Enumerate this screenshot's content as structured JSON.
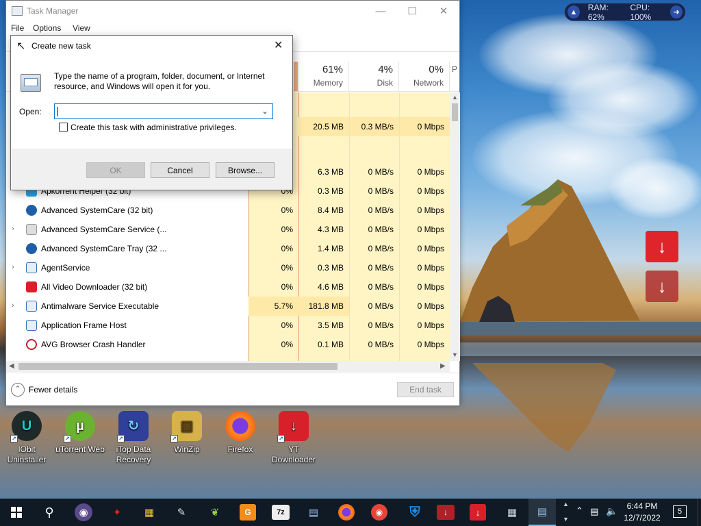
{
  "task_manager": {
    "title": "Task Manager",
    "menu": [
      "File",
      "Options",
      "View"
    ],
    "columns": [
      {
        "percent": "61%",
        "label": "Memory"
      },
      {
        "percent": "4%",
        "label": "Disk"
      },
      {
        "percent": "0%",
        "label": "Network"
      },
      {
        "percent": "",
        "label": "P"
      }
    ],
    "rows_partial": [
      {
        "cpu": "",
        "memory": "20.5 MB",
        "disk": "0.3 MB/s",
        "network": "0 Mbps"
      },
      {
        "cpu": "",
        "memory": "6.3 MB",
        "disk": "0 MB/s",
        "network": "0 Mbps"
      }
    ],
    "processes": [
      {
        "name": "Apkorrent Helper (32 bit)",
        "cpu": "0%",
        "memory": "0.3 MB",
        "disk": "0 MB/s",
        "network": "0 Mbps",
        "expand": false
      },
      {
        "name": "Advanced SystemCare (32 bit)",
        "cpu": "0%",
        "memory": "8.4 MB",
        "disk": "0 MB/s",
        "network": "0 Mbps",
        "expand": false
      },
      {
        "name": "Advanced SystemCare Service (...",
        "cpu": "0%",
        "memory": "4.3 MB",
        "disk": "0 MB/s",
        "network": "0 Mbps",
        "expand": true
      },
      {
        "name": "Advanced SystemCare Tray (32 ...",
        "cpu": "0%",
        "memory": "1.4 MB",
        "disk": "0 MB/s",
        "network": "0 Mbps",
        "expand": false
      },
      {
        "name": "AgentService",
        "cpu": "0%",
        "memory": "0.3 MB",
        "disk": "0 MB/s",
        "network": "0 Mbps",
        "expand": true
      },
      {
        "name": "All Video Downloader (32 bit)",
        "cpu": "0%",
        "memory": "4.6 MB",
        "disk": "0 MB/s",
        "network": "0 Mbps",
        "expand": false
      },
      {
        "name": "Antimalware Service Executable",
        "cpu": "5.7%",
        "memory": "181.8 MB",
        "disk": "0 MB/s",
        "network": "0 Mbps",
        "expand": true
      },
      {
        "name": "Application Frame Host",
        "cpu": "0%",
        "memory": "3.5 MB",
        "disk": "0 MB/s",
        "network": "0 Mbps",
        "expand": false
      },
      {
        "name": "AVG Browser Crash Handler",
        "cpu": "0%",
        "memory": "0.1 MB",
        "disk": "0 MB/s",
        "network": "0 Mbps",
        "expand": false
      }
    ],
    "fewer_details": "Fewer details",
    "end_task": "End task"
  },
  "dialog": {
    "title": "Create new task",
    "description": "Type the name of a program, folder, document, or Internet resource, and Windows will open it for you.",
    "open_label": "Open:",
    "open_value": "",
    "admin_checkbox": "Create this task with administrative privileges.",
    "ok": "OK",
    "cancel": "Cancel",
    "browse": "Browse..."
  },
  "widget": {
    "ram": "RAM: 62%",
    "cpu": "CPU: 100%"
  },
  "desktop_icons": [
    {
      "label": "IObit Uninstaller",
      "icon": "iobit-uninstaller-icon",
      "color": "#1e2a2a"
    },
    {
      "label": "uTorrent Web",
      "icon": "utorrent-icon",
      "color": "#6ab22f"
    },
    {
      "label": "iTop Data Recovery",
      "icon": "itop-recovery-icon",
      "color": "#2f3f9a"
    },
    {
      "label": "WinZip",
      "icon": "winzip-icon",
      "color": "#c79a2a"
    },
    {
      "label": "Firefox",
      "icon": "firefox-icon",
      "color": "#e66000"
    },
    {
      "label": "YT Downloader",
      "icon": "yt-downloader-icon",
      "color": "#d8202a"
    }
  ],
  "taskbar": {
    "time": "6:44 PM",
    "date": "12/7/2022",
    "notifications": "5"
  },
  "colors": {
    "accent": "#0078d7",
    "heat_light": "#fff4c4",
    "heat_mid": "#ffe9a8"
  }
}
